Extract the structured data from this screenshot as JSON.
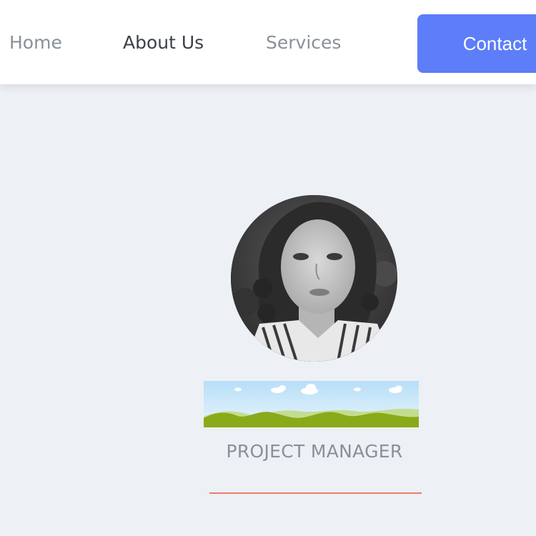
{
  "nav": {
    "home": "Home",
    "about": "About Us",
    "services": "Services",
    "contact": "Contact"
  },
  "profile": {
    "role": "PROJECT MANAGER"
  },
  "colors": {
    "accent": "#5d7ef8",
    "divider": "#ec7a6f",
    "background": "#edf0f4"
  },
  "icons": {
    "avatar": "profile-photo",
    "banner": "landscape-image"
  }
}
